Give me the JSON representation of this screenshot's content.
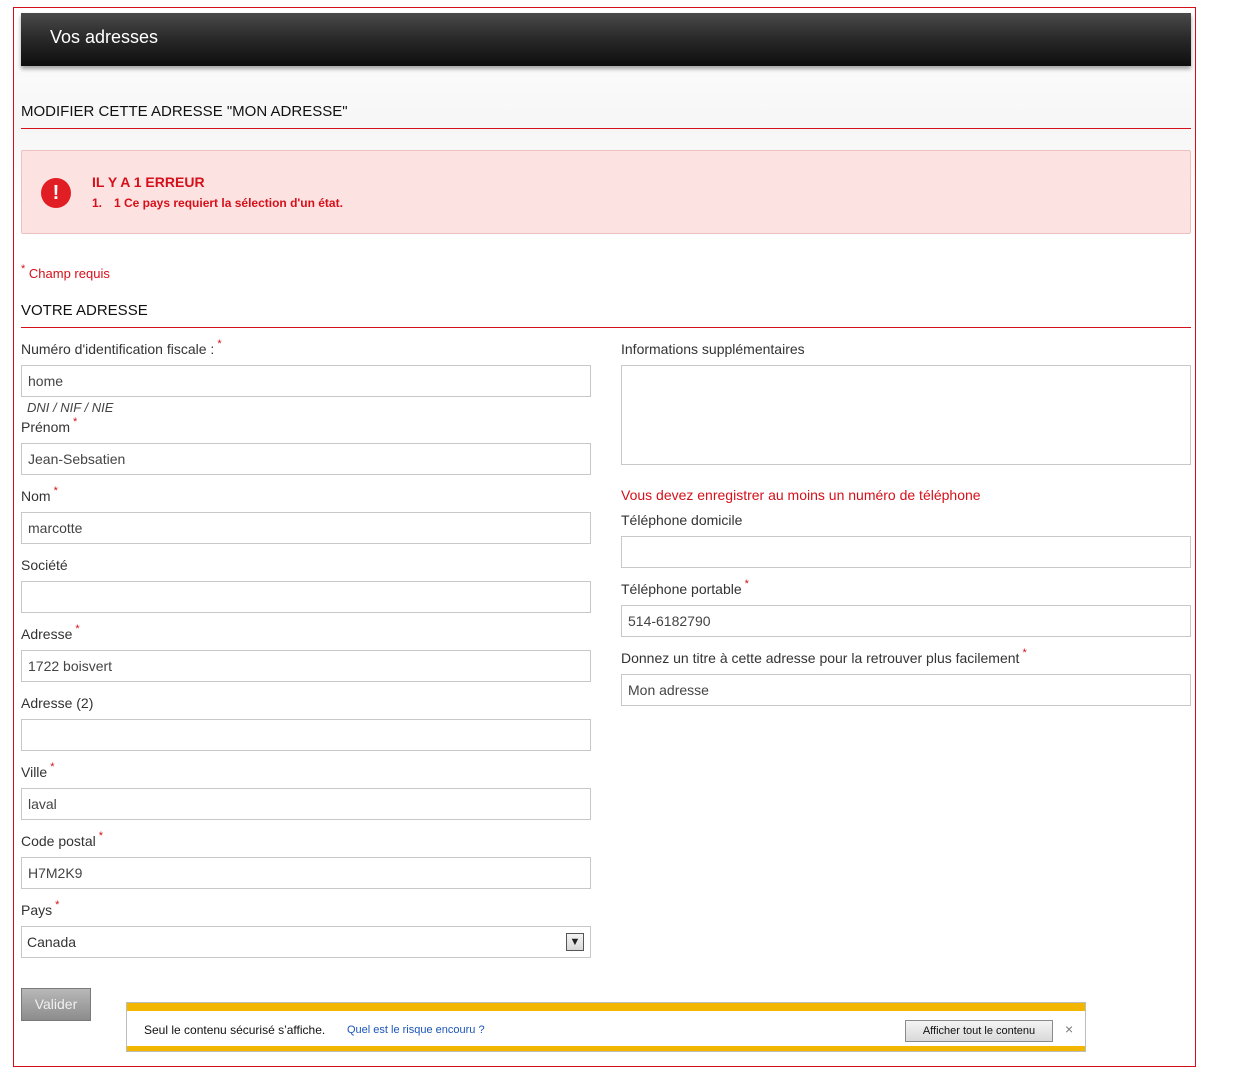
{
  "header": {
    "title": "Vos adresses"
  },
  "page_heading": "MODIFIER CETTE ADRESSE \"MON ADRESSE\"",
  "alert": {
    "title": "IL Y A 1 ERREUR",
    "icon": "exclamation-icon",
    "items": [
      {
        "num": "1.",
        "text": "1 Ce pays requiert la sélection d'un état."
      }
    ]
  },
  "required_note": "Champ requis",
  "required_star": "*",
  "section_heading": "VOTRE ADRESSE",
  "fields": {
    "tax_id": {
      "label": "Numéro d'identification fiscale :",
      "value": "home",
      "hint": "DNI / NIF / NIE"
    },
    "firstname": {
      "label": "Prénom",
      "value": "Jean-Sebsatien"
    },
    "lastname": {
      "label": "Nom",
      "value": "marcotte"
    },
    "company": {
      "label": "Société",
      "value": ""
    },
    "address1": {
      "label": "Adresse",
      "value": "1722 boisvert"
    },
    "address2": {
      "label": "Adresse (2)",
      "value": ""
    },
    "city": {
      "label": "Ville",
      "value": "laval"
    },
    "postcode": {
      "label": "Code postal",
      "value": "H7M2K9"
    },
    "country": {
      "label": "Pays",
      "value": "Canada"
    },
    "other": {
      "label": "Informations supplémentaires",
      "value": ""
    },
    "phone_note": "Vous devez enregistrer au moins un numéro de téléphone",
    "phone_home": {
      "label": "Téléphone domicile",
      "value": ""
    },
    "phone_mobile": {
      "label": "Téléphone portable",
      "value": "514-6182790"
    },
    "alias": {
      "label": "Donnez un titre à cette adresse pour la retrouver plus facilement",
      "value": "Mon adresse"
    }
  },
  "submit_label": "Valider",
  "infobar": {
    "message": "Seul le contenu sécurisé s’affiche.",
    "link": "Quel est le risque encouru ?",
    "button": "Afficher tout le contenu",
    "close": "×"
  },
  "colors": {
    "accent": "#d5101a",
    "alert_bg": "#fde2e2",
    "infobar_stripe": "#f2b600"
  }
}
